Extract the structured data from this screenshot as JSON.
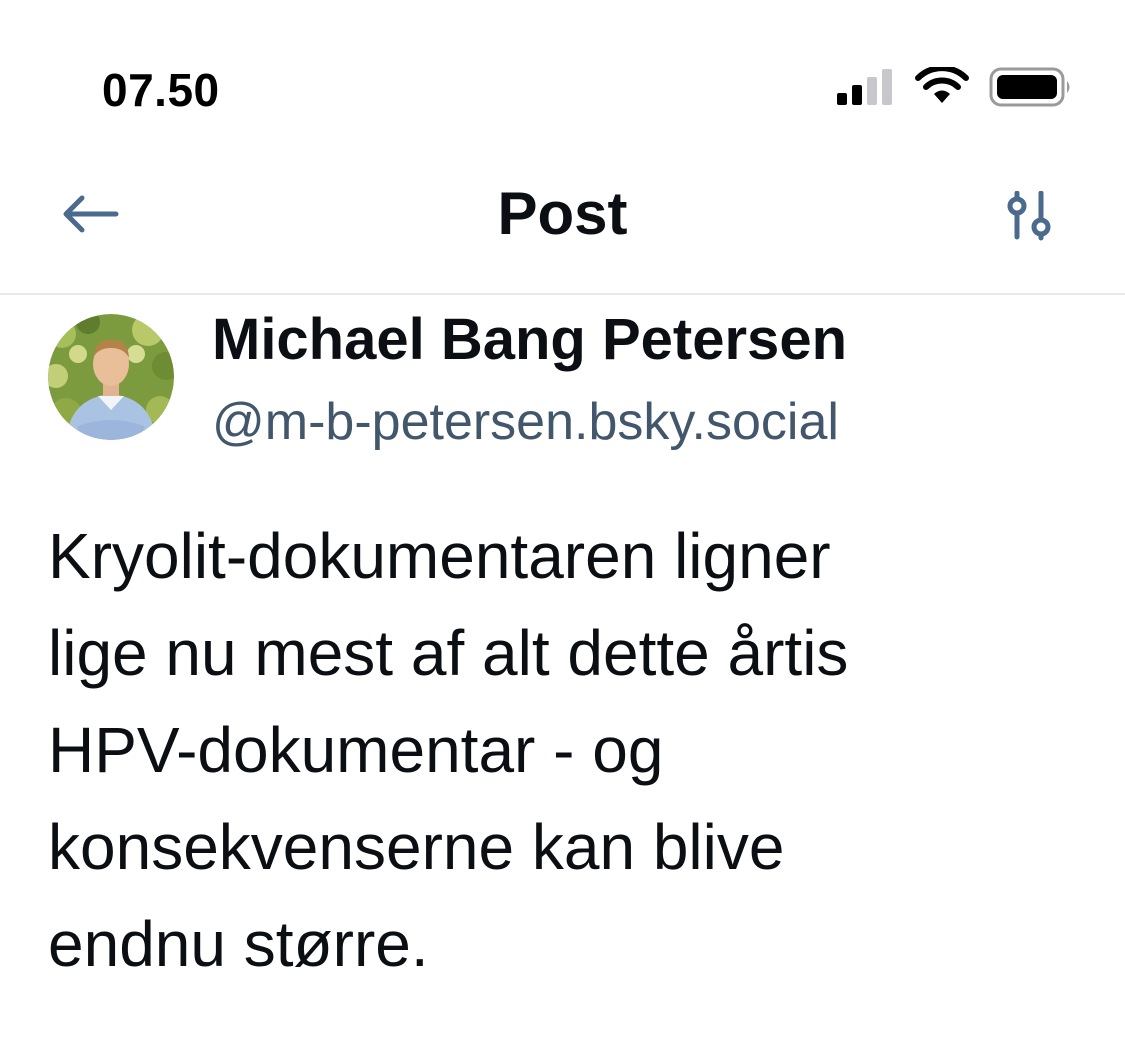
{
  "status_bar": {
    "time": "07.50",
    "icons": [
      "cellular-signal-icon",
      "wifi-icon",
      "battery-icon"
    ]
  },
  "header": {
    "title": "Post",
    "back_icon": "arrow-left-icon",
    "filter_icon": "sliders-icon"
  },
  "post": {
    "author": {
      "display_name": "Michael Bang Petersen",
      "handle": "@m-b-petersen.bsky.social"
    },
    "lines": [
      "Kryolit-dokumentaren ligner",
      "lige nu mest af alt dette årtis",
      "HPV-dokumentar - og",
      "konsekvenserne kan blive",
      "endnu større."
    ]
  },
  "colors": {
    "text_primary": "#0b0f14",
    "text_secondary": "#42576c",
    "icon_accent": "#4a6a8e",
    "divider": "#e6e9ee"
  }
}
